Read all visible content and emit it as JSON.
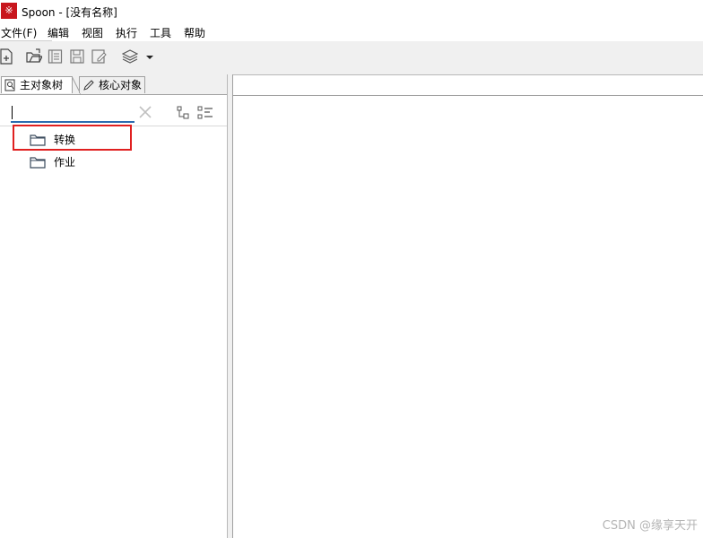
{
  "window": {
    "app_icon_glyph": "※",
    "title": "Spoon - [没有名称]"
  },
  "menu": [
    {
      "label": "文件(F)"
    },
    {
      "label": "编辑"
    },
    {
      "label": "视图"
    },
    {
      "label": "执行"
    },
    {
      "label": "工具"
    },
    {
      "label": "帮助"
    }
  ],
  "toolbar": {
    "icons": [
      "new-file-icon",
      "open-folder-icon",
      "explore-repository-icon",
      "save-icon",
      "save-as-icon",
      "perspective-layers-icon",
      "dropdown-arrow-icon"
    ]
  },
  "left_panel": {
    "tabs": [
      {
        "label": "主对象树",
        "icon": "search-doc-icon",
        "active": true
      },
      {
        "label": "核心对象",
        "icon": "pencil-icon",
        "active": false
      }
    ],
    "search": {
      "value": "",
      "placeholder": ""
    },
    "tree": [
      {
        "label": "转换",
        "icon": "folder-icon",
        "highlighted": true
      },
      {
        "label": "作业",
        "icon": "folder-icon",
        "highlighted": false
      }
    ]
  },
  "watermark": "CSDN @缘享天开",
  "colors": {
    "highlight_border": "#e02020",
    "search_underline": "#2b6cb0",
    "app_icon_bg": "#c8161d"
  }
}
